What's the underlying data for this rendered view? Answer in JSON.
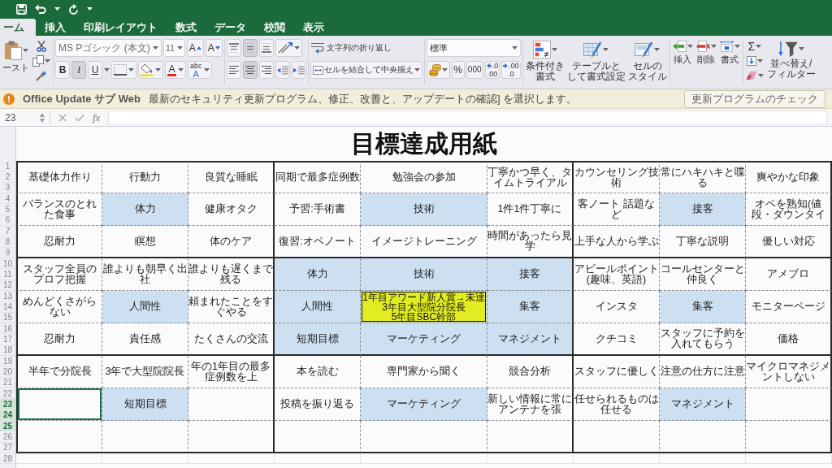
{
  "tabs": [
    {
      "label": "ーム",
      "selected": true
    },
    {
      "label": "挿入",
      "selected": false
    },
    {
      "label": "印刷レイアウト",
      "selected": false
    },
    {
      "label": "数式",
      "selected": false
    },
    {
      "label": "データ",
      "selected": false
    },
    {
      "label": "校閲",
      "selected": false
    },
    {
      "label": "表示",
      "selected": false
    }
  ],
  "ribbon": {
    "clipboard": {
      "paste_label": "ースト"
    },
    "font": {
      "name": "MS Pゴシック (本文)",
      "size": "11",
      "grow": "A",
      "shrink": "A",
      "styles": [
        {
          "kind": "bold",
          "label": "B",
          "pressed": false
        },
        {
          "kind": "italic",
          "label": "I",
          "pressed": true
        },
        {
          "kind": "underline",
          "label": "U",
          "pressed": false
        }
      ],
      "font_color": "A",
      "phonetic": {
        "top": "abc",
        "bottom": "A"
      }
    },
    "alignment": {
      "vertical": [
        {
          "kind": "top",
          "pressed": false
        },
        {
          "kind": "middle",
          "pressed": true
        },
        {
          "kind": "bottom",
          "pressed": false
        }
      ],
      "horizontal": [
        {
          "kind": "left",
          "pressed": false
        },
        {
          "kind": "center",
          "pressed": true
        },
        {
          "kind": "right",
          "pressed": false
        }
      ],
      "wrap_text": "文字列の折り返し",
      "merge_center": "セルを結合して中央揃え"
    },
    "number": {
      "format": "標準",
      "percent": "%",
      "comma": "000",
      "decimals": [
        {
          "kind": "increase",
          "top": ".0",
          "bottom": ".00"
        },
        {
          "kind": "decrease",
          "top": ".00",
          "bottom": ".0"
        }
      ]
    },
    "styles": [
      {
        "kind": "conditional",
        "lines": [
          "条件付き",
          "書式"
        ]
      },
      {
        "kind": "table",
        "lines": [
          "テーブルと",
          "して書式設定"
        ]
      },
      {
        "kind": "cell",
        "lines": [
          "セルの",
          "スタイル"
        ]
      }
    ],
    "cells": [
      {
        "kind": "insert",
        "label": "挿入"
      },
      {
        "kind": "delete",
        "label": "削除"
      },
      {
        "kind": "format",
        "label": "書式"
      }
    ],
    "editing": {
      "sum": "Σ",
      "sort_filter": "並べ替え/フィルター"
    }
  },
  "message_bar": {
    "title": "Office Update サブ Web",
    "text": "最新のセキュリティ更新プログラム、修正、改善と、アップデートの確認] を選択します。",
    "button": "更新プログラムのチェック"
  },
  "formula_bar": {
    "name_box": "23",
    "function_label": "fx"
  },
  "sheet": {
    "title": "目標達成用紙",
    "row_numbers": [
      {
        "label": "1",
        "selected": false
      },
      {
        "label": "2",
        "selected": false
      },
      {
        "label": "3",
        "selected": false
      },
      {
        "label": "4",
        "selected": false
      },
      {
        "label": "5",
        "selected": false
      },
      {
        "label": "6",
        "selected": false
      },
      {
        "label": "7",
        "selected": false
      },
      {
        "label": "8",
        "selected": false
      },
      {
        "label": "9",
        "selected": false
      },
      {
        "label": "10",
        "selected": false
      },
      {
        "label": "11",
        "selected": false
      },
      {
        "label": "12",
        "selected": false
      },
      {
        "label": "13",
        "selected": false
      },
      {
        "label": "14",
        "selected": false
      },
      {
        "label": "15",
        "selected": false
      },
      {
        "label": "16",
        "selected": false
      },
      {
        "label": "17",
        "selected": false
      },
      {
        "label": "18",
        "selected": false
      },
      {
        "label": "19",
        "selected": false
      },
      {
        "label": "20",
        "selected": false
      },
      {
        "label": "21",
        "selected": false
      },
      {
        "label": "22",
        "selected": false
      },
      {
        "label": "23",
        "selected": true
      },
      {
        "label": "24",
        "selected": true
      },
      {
        "label": "25",
        "selected": true
      },
      {
        "label": "26",
        "selected": false
      },
      {
        "label": "27",
        "selected": false
      },
      {
        "label": "28",
        "selected": false
      }
    ],
    "chart_rows": [
      [
        {
          "text": "基礎体力作り",
          "kind": "plain",
          "selected": false
        },
        {
          "text": "行動力",
          "kind": "plain",
          "selected": false
        },
        {
          "text": "良質な睡眠",
          "kind": "plain",
          "selected": false
        },
        {
          "text": "同期で最多症例数",
          "kind": "plain",
          "selected": false
        },
        {
          "text": "勉強会の参加",
          "kind": "plain",
          "selected": false
        },
        {
          "text": "丁寧かつ早く、タイムトライアル",
          "kind": "plain",
          "selected": false
        },
        {
          "text": "カウンセリング技術",
          "kind": "plain",
          "selected": false
        },
        {
          "text": "常にハキハキと喋る",
          "kind": "plain",
          "selected": false
        },
        {
          "text": "爽やかな印象",
          "kind": "plain",
          "selected": false
        }
      ],
      [
        {
          "text": "バランスのとれた食事",
          "kind": "plain",
          "selected": false
        },
        {
          "text": "体力",
          "kind": "theme",
          "selected": false
        },
        {
          "text": "健康オタク",
          "kind": "plain",
          "selected": false
        },
        {
          "text": "予習:手術書",
          "kind": "plain",
          "selected": false
        },
        {
          "text": "技術",
          "kind": "theme",
          "selected": false
        },
        {
          "text": "1件1件丁寧に",
          "kind": "plain",
          "selected": false
        },
        {
          "text": "客ノート 話題など",
          "kind": "plain",
          "selected": false
        },
        {
          "text": "接客",
          "kind": "theme",
          "selected": false
        },
        {
          "text": "オペを熟知(値段・ダウンタイ",
          "kind": "plain",
          "selected": false
        }
      ],
      [
        {
          "text": "忍耐力",
          "kind": "plain",
          "selected": false
        },
        {
          "text": "瞑想",
          "kind": "plain",
          "selected": false
        },
        {
          "text": "体のケア",
          "kind": "plain",
          "selected": false
        },
        {
          "text": "復習:オペノート",
          "kind": "plain",
          "selected": false
        },
        {
          "text": "イメージトレーニング",
          "kind": "plain",
          "selected": false
        },
        {
          "text": "時間があったら見学",
          "kind": "plain",
          "selected": false
        },
        {
          "text": "上手な人から学ぶ",
          "kind": "plain",
          "selected": false
        },
        {
          "text": "丁寧な説明",
          "kind": "plain",
          "selected": false
        },
        {
          "text": "優しい対応",
          "kind": "plain",
          "selected": false
        }
      ],
      [
        {
          "text": "スタッフ全員のプロフ把握",
          "kind": "plain",
          "selected": false
        },
        {
          "text": "誰よりも朝早く出社",
          "kind": "plain",
          "selected": false
        },
        {
          "text": "誰よりも遅くまで残る",
          "kind": "plain",
          "selected": false
        },
        {
          "text": "体力",
          "kind": "theme",
          "selected": false
        },
        {
          "text": "技術",
          "kind": "theme",
          "selected": false
        },
        {
          "text": "接客",
          "kind": "theme",
          "selected": false
        },
        {
          "text": "アピールポイント(趣味、英語)",
          "kind": "plain",
          "selected": false
        },
        {
          "text": "コールセンターと仲良く",
          "kind": "plain",
          "selected": false
        },
        {
          "text": "アメブロ",
          "kind": "plain",
          "selected": false
        }
      ],
      [
        {
          "text": "めんどくさがらない",
          "kind": "plain",
          "selected": false
        },
        {
          "text": "人間性",
          "kind": "theme",
          "selected": false
        },
        {
          "text": "頼まれたことをすぐやる",
          "kind": "plain",
          "selected": false
        },
        {
          "text": "人間性",
          "kind": "theme",
          "selected": false
        },
        {
          "lines": [
            "1年目アワード新人賞→未達",
            "3年目大型院分院長",
            "5年目SBC幹部"
          ],
          "kind": "goal",
          "selected": false
        },
        {
          "text": "集客",
          "kind": "theme",
          "selected": false
        },
        {
          "text": "インスタ",
          "kind": "plain",
          "selected": false
        },
        {
          "text": "集客",
          "kind": "theme",
          "selected": false
        },
        {
          "text": "モニターページ",
          "kind": "plain",
          "selected": false
        }
      ],
      [
        {
          "text": "忍耐力",
          "kind": "plain",
          "selected": false
        },
        {
          "text": "責任感",
          "kind": "plain",
          "selected": false
        },
        {
          "text": "たくさんの交流",
          "kind": "plain",
          "selected": false
        },
        {
          "text": "短期目標",
          "kind": "theme",
          "selected": false
        },
        {
          "text": "マーケティング",
          "kind": "theme",
          "selected": false
        },
        {
          "text": "マネジメント",
          "kind": "theme",
          "selected": false
        },
        {
          "text": "クチコミ",
          "kind": "plain",
          "selected": false
        },
        {
          "text": "スタッフに予約を入れてもらう",
          "kind": "plain",
          "selected": false
        },
        {
          "text": "価格",
          "kind": "plain",
          "selected": false
        }
      ],
      [
        {
          "text": "半年で分院長",
          "kind": "plain",
          "selected": false
        },
        {
          "text": "3年で大型院院長",
          "kind": "plain",
          "selected": false
        },
        {
          "text": "年の1年目の最多症例数を上",
          "kind": "plain",
          "selected": false
        },
        {
          "text": "本を読む",
          "kind": "plain",
          "selected": false
        },
        {
          "text": "専門家から聞く",
          "kind": "plain",
          "selected": false
        },
        {
          "text": "競合分析",
          "kind": "plain",
          "selected": false
        },
        {
          "text": "スタッフに優しく",
          "kind": "plain",
          "selected": false
        },
        {
          "text": "注意の仕方に注意",
          "kind": "plain",
          "selected": false
        },
        {
          "text": "マイクロマネジメントしない",
          "kind": "plain",
          "selected": false
        }
      ],
      [
        {
          "kind": "plain",
          "selected": true
        },
        {
          "text": "短期目標",
          "kind": "theme",
          "selected": false
        },
        {
          "kind": "plain",
          "selected": false
        },
        {
          "text": "投稿を振り返る",
          "kind": "plain",
          "selected": false
        },
        {
          "text": "マーケティング",
          "kind": "theme",
          "selected": false
        },
        {
          "text": "新しい情報に常にアンテナを張",
          "kind": "plain",
          "selected": false
        },
        {
          "text": "任せられるものは任せる",
          "kind": "plain",
          "selected": false
        },
        {
          "text": "マネジメント",
          "kind": "theme",
          "selected": false
        },
        {
          "kind": "plain",
          "selected": false
        }
      ],
      [
        {
          "kind": "plain",
          "selected": false
        },
        {
          "kind": "plain",
          "selected": false
        },
        {
          "kind": "plain",
          "selected": false
        },
        {
          "kind": "plain",
          "selected": false
        },
        {
          "kind": "plain",
          "selected": false
        },
        {
          "kind": "plain",
          "selected": false
        },
        {
          "kind": "plain",
          "selected": false
        },
        {
          "kind": "plain",
          "selected": false
        },
        {
          "kind": "plain",
          "selected": false
        }
      ]
    ]
  }
}
